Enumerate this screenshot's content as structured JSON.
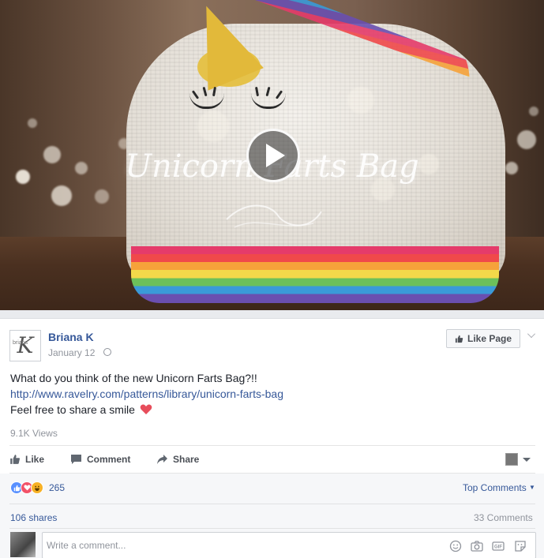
{
  "video": {
    "title": "Unicorn Farts Bag"
  },
  "post": {
    "page_name": "Briana K",
    "avatar_text": "brians",
    "avatar_letter": "K",
    "date": "January 12",
    "like_page_label": "Like Page",
    "text_line1": "What do you think of the new Unicorn Farts Bag?!!",
    "link": "http://www.ravelry.com/patterns/library/unicorn-farts-bag",
    "text_line3": "Feel free to share a smile",
    "views": "9.1K Views"
  },
  "actions": {
    "like": "Like",
    "comment": "Comment",
    "share": "Share"
  },
  "stats": {
    "reaction_count": "265",
    "top_comments": "Top Comments",
    "shares": "106 shares",
    "comments": "33 Comments"
  },
  "comment_box": {
    "placeholder": "Write a comment..."
  },
  "icons": [
    "play-icon",
    "globe-icon",
    "thumbs-up-icon",
    "chevron-down-icon",
    "comment-icon",
    "share-icon",
    "like-reaction-icon",
    "love-reaction-icon",
    "haha-reaction-icon",
    "emoji-icon",
    "camera-icon",
    "gif-icon",
    "sticker-icon",
    "heart-icon"
  ],
  "colors": {
    "link": "#365899",
    "muted": "#90949c",
    "like_blue": "#5890ff",
    "love_red": "#f25268",
    "haha_yellow": "#f7b125"
  }
}
